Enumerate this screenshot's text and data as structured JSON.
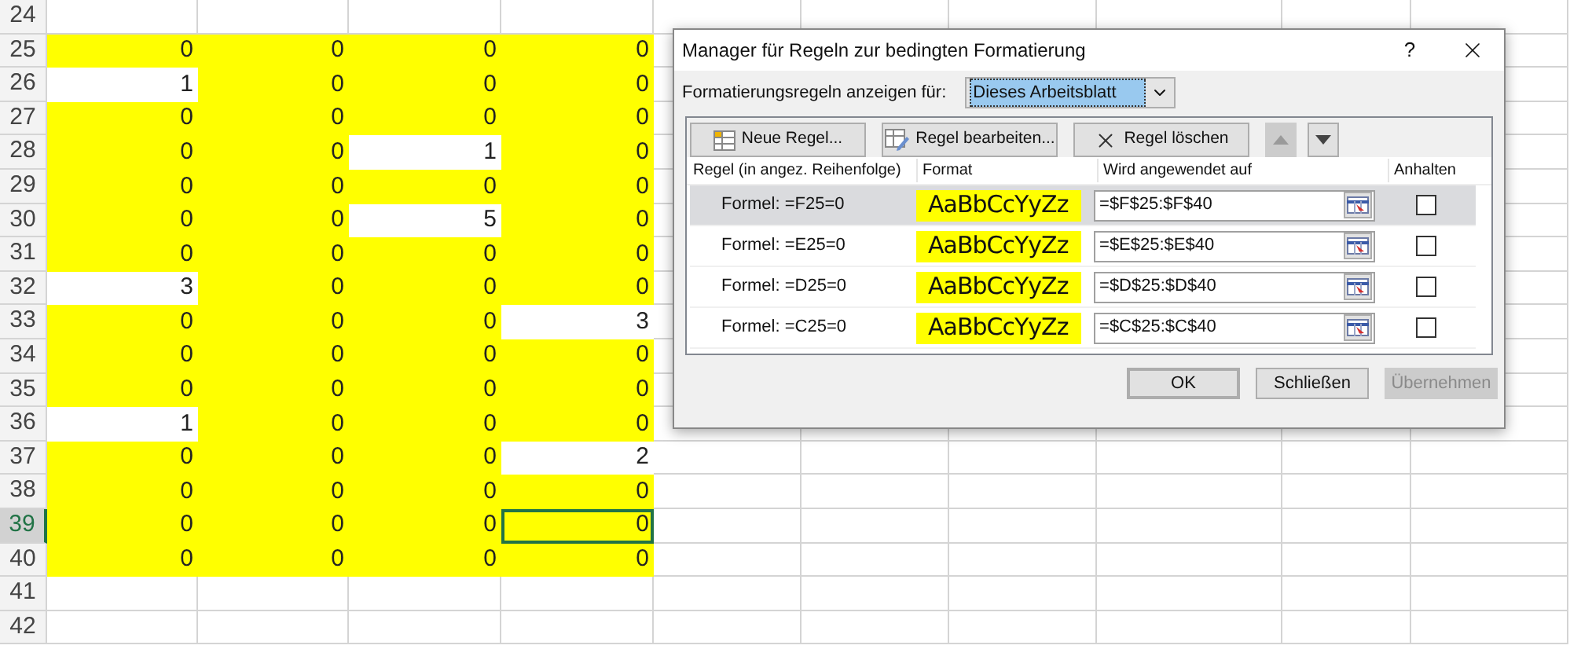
{
  "sheet": {
    "rows": [
      {
        "label": "24",
        "selected": false,
        "cells": []
      },
      {
        "label": "25",
        "selected": false,
        "cells": [
          {
            "value": "0",
            "highlighted": true,
            "selected": false
          },
          {
            "value": "0",
            "highlighted": true,
            "selected": false
          },
          {
            "value": "0",
            "highlighted": true,
            "selected": false
          },
          {
            "value": "0",
            "highlighted": true,
            "selected": false
          }
        ]
      },
      {
        "label": "26",
        "selected": false,
        "cells": [
          {
            "value": "1",
            "highlighted": false,
            "selected": false
          },
          {
            "value": "0",
            "highlighted": true,
            "selected": false
          },
          {
            "value": "0",
            "highlighted": true,
            "selected": false
          },
          {
            "value": "0",
            "highlighted": true,
            "selected": false
          }
        ]
      },
      {
        "label": "27",
        "selected": false,
        "cells": [
          {
            "value": "0",
            "highlighted": true,
            "selected": false
          },
          {
            "value": "0",
            "highlighted": true,
            "selected": false
          },
          {
            "value": "0",
            "highlighted": true,
            "selected": false
          },
          {
            "value": "0",
            "highlighted": true,
            "selected": false
          }
        ]
      },
      {
        "label": "28",
        "selected": false,
        "cells": [
          {
            "value": "0",
            "highlighted": true,
            "selected": false
          },
          {
            "value": "0",
            "highlighted": true,
            "selected": false
          },
          {
            "value": "1",
            "highlighted": false,
            "selected": false
          },
          {
            "value": "0",
            "highlighted": true,
            "selected": false
          }
        ]
      },
      {
        "label": "29",
        "selected": false,
        "cells": [
          {
            "value": "0",
            "highlighted": true,
            "selected": false
          },
          {
            "value": "0",
            "highlighted": true,
            "selected": false
          },
          {
            "value": "0",
            "highlighted": true,
            "selected": false
          },
          {
            "value": "0",
            "highlighted": true,
            "selected": false
          }
        ]
      },
      {
        "label": "30",
        "selected": false,
        "cells": [
          {
            "value": "0",
            "highlighted": true,
            "selected": false
          },
          {
            "value": "0",
            "highlighted": true,
            "selected": false
          },
          {
            "value": "5",
            "highlighted": false,
            "selected": false
          },
          {
            "value": "0",
            "highlighted": true,
            "selected": false
          }
        ]
      },
      {
        "label": "31",
        "selected": false,
        "cells": [
          {
            "value": "0",
            "highlighted": true,
            "selected": false
          },
          {
            "value": "0",
            "highlighted": true,
            "selected": false
          },
          {
            "value": "0",
            "highlighted": true,
            "selected": false
          },
          {
            "value": "0",
            "highlighted": true,
            "selected": false
          }
        ]
      },
      {
        "label": "32",
        "selected": false,
        "cells": [
          {
            "value": "3",
            "highlighted": false,
            "selected": false
          },
          {
            "value": "0",
            "highlighted": true,
            "selected": false
          },
          {
            "value": "0",
            "highlighted": true,
            "selected": false
          },
          {
            "value": "0",
            "highlighted": true,
            "selected": false
          }
        ]
      },
      {
        "label": "33",
        "selected": false,
        "cells": [
          {
            "value": "0",
            "highlighted": true,
            "selected": false
          },
          {
            "value": "0",
            "highlighted": true,
            "selected": false
          },
          {
            "value": "0",
            "highlighted": true,
            "selected": false
          },
          {
            "value": "3",
            "highlighted": false,
            "selected": false
          }
        ]
      },
      {
        "label": "34",
        "selected": false,
        "cells": [
          {
            "value": "0",
            "highlighted": true,
            "selected": false
          },
          {
            "value": "0",
            "highlighted": true,
            "selected": false
          },
          {
            "value": "0",
            "highlighted": true,
            "selected": false
          },
          {
            "value": "0",
            "highlighted": true,
            "selected": false
          }
        ]
      },
      {
        "label": "35",
        "selected": false,
        "cells": [
          {
            "value": "0",
            "highlighted": true,
            "selected": false
          },
          {
            "value": "0",
            "highlighted": true,
            "selected": false
          },
          {
            "value": "0",
            "highlighted": true,
            "selected": false
          },
          {
            "value": "0",
            "highlighted": true,
            "selected": false
          }
        ]
      },
      {
        "label": "36",
        "selected": false,
        "cells": [
          {
            "value": "1",
            "highlighted": false,
            "selected": false
          },
          {
            "value": "0",
            "highlighted": true,
            "selected": false
          },
          {
            "value": "0",
            "highlighted": true,
            "selected": false
          },
          {
            "value": "0",
            "highlighted": true,
            "selected": false
          }
        ]
      },
      {
        "label": "37",
        "selected": false,
        "cells": [
          {
            "value": "0",
            "highlighted": true,
            "selected": false
          },
          {
            "value": "0",
            "highlighted": true,
            "selected": false
          },
          {
            "value": "0",
            "highlighted": true,
            "selected": false
          },
          {
            "value": "2",
            "highlighted": false,
            "selected": false
          }
        ]
      },
      {
        "label": "38",
        "selected": false,
        "cells": [
          {
            "value": "0",
            "highlighted": true,
            "selected": false
          },
          {
            "value": "0",
            "highlighted": true,
            "selected": false
          },
          {
            "value": "0",
            "highlighted": true,
            "selected": false
          },
          {
            "value": "0",
            "highlighted": true,
            "selected": false
          }
        ]
      },
      {
        "label": "39",
        "selected": true,
        "cells": [
          {
            "value": "0",
            "highlighted": true,
            "selected": false
          },
          {
            "value": "0",
            "highlighted": true,
            "selected": false
          },
          {
            "value": "0",
            "highlighted": true,
            "selected": false
          },
          {
            "value": "0",
            "highlighted": true,
            "selected": true
          }
        ]
      },
      {
        "label": "40",
        "selected": false,
        "cells": [
          {
            "value": "0",
            "highlighted": true,
            "selected": false
          },
          {
            "value": "0",
            "highlighted": true,
            "selected": false
          },
          {
            "value": "0",
            "highlighted": true,
            "selected": false
          },
          {
            "value": "0",
            "highlighted": true,
            "selected": false
          }
        ]
      },
      {
        "label": "41",
        "selected": false,
        "cells": []
      },
      {
        "label": "42",
        "selected": false,
        "cells": []
      }
    ]
  },
  "dialog": {
    "title": "Manager für Regeln zur bedingten Formatierung",
    "help": "?",
    "scope_label": "Formatierungsregeln anzeigen für:",
    "scope_value": "Dieses Arbeitsblatt",
    "toolbar": [
      {
        "kind": "new",
        "label": "Neue Regel...",
        "disabled": false
      },
      {
        "kind": "edit",
        "label": "Regel bearbeiten...",
        "disabled": false
      },
      {
        "kind": "delete",
        "label": "Regel löschen",
        "disabled": false
      },
      {
        "kind": "up",
        "disabled": true
      },
      {
        "kind": "down",
        "disabled": false
      }
    ],
    "columns": [
      "Regel (in angez. Reihenfolge)",
      "Format",
      "Wird angewendet auf",
      "Anhalten"
    ],
    "rules": [
      {
        "condition": "Formel: =F25=0",
        "preview": "AaBbCcYyZz",
        "applies_to": "=$F$25:$F$40",
        "stop_if_true": false,
        "selected": true
      },
      {
        "condition": "Formel: =E25=0",
        "preview": "AaBbCcYyZz",
        "applies_to": "=$E$25:$E$40",
        "stop_if_true": false,
        "selected": false
      },
      {
        "condition": "Formel: =D25=0",
        "preview": "AaBbCcYyZz",
        "applies_to": "=$D$25:$D$40",
        "stop_if_true": false,
        "selected": false
      },
      {
        "condition": "Formel: =C25=0",
        "preview": "AaBbCcYyZz",
        "applies_to": "=$C$25:$C$40",
        "stop_if_true": false,
        "selected": false
      }
    ],
    "buttons": [
      {
        "label": "OK",
        "default": true,
        "disabled": false
      },
      {
        "label": "Schließen",
        "default": false,
        "disabled": false
      },
      {
        "label": "Übernehmen",
        "default": false,
        "disabled": true
      }
    ]
  }
}
